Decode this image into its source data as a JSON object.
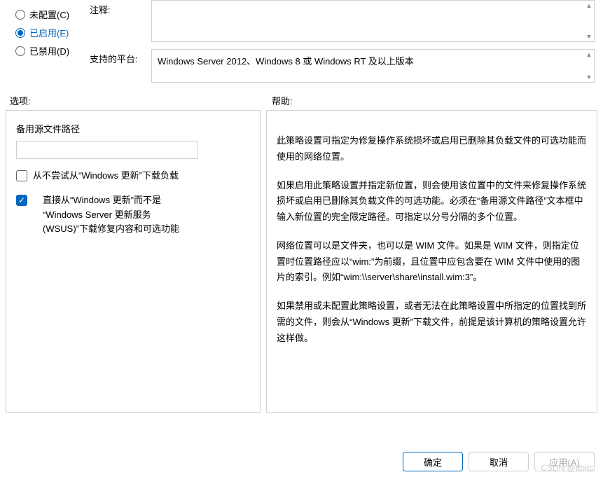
{
  "radios": {
    "not_configured": "未配置(C)",
    "enabled": "已启用(E)",
    "disabled": "已禁用(D)",
    "selected": "enabled"
  },
  "fields": {
    "comment_label": "注释:",
    "comment_value": "",
    "platform_label": "支持的平台:",
    "platform_value": "Windows Server 2012、Windows 8 或 Windows RT 及以上版本"
  },
  "section_labels": {
    "options": "选项:",
    "help": "帮助:"
  },
  "options": {
    "path_label": "备用源文件路径",
    "path_value": "",
    "chk_no_wu": {
      "label": "从不尝试从“Windows 更新”下载负载",
      "checked": false
    },
    "chk_wsus": {
      "label_line1": "直接从“Windows 更新”而不是",
      "label_line2": "“Windows Server 更新服务",
      "label_line3": "(WSUS)”下载修复内容和可选功能",
      "checked": true
    }
  },
  "help": {
    "p1": "此策略设置可指定为修复操作系统损坏或启用已删除其负载文件的可选功能而使用的网络位置。",
    "p2": "如果启用此策略设置并指定新位置，则会使用该位置中的文件来修复操作系统损坏或启用已删除其负载文件的可选功能。必须在“备用源文件路径”文本框中输入新位置的完全限定路径。可指定以分号分隔的多个位置。",
    "p3": "网络位置可以是文件夹，也可以是 WIM 文件。如果是 WIM 文件，则指定位置时位置路径应以“wim:”为前缀，且位置中应包含要在 WIM 文件中使用的图片的索引。例如“wim:\\\\server\\share\\install.wim:3”。",
    "p4": "如果禁用或未配置此策略设置，或者无法在此策略设置中所指定的位置找到所需的文件，则会从“Windows 更新”下载文件，前提是该计算机的策略设置允许这样做。"
  },
  "buttons": {
    "ok": "确定",
    "cancel": "取消",
    "apply": "应用(A)"
  },
  "watermark": "CSDN @dbitc"
}
